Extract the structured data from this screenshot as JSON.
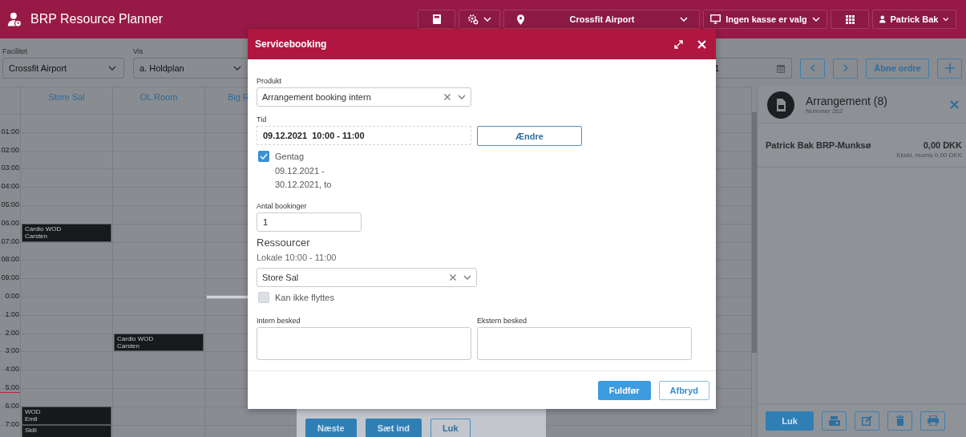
{
  "header": {
    "title": "BRP Resource Planner",
    "location": "Crossfit Airport",
    "register": "Ingen kasse er valg",
    "user": "Patrick Bak"
  },
  "toolbar": {
    "facility": {
      "label": "Facilitet",
      "value": "Crossfit Airport"
    },
    "view": {
      "label": "Vis",
      "value": "a. Holdplan"
    },
    "date": {
      "value": "1"
    },
    "open_orders_button": "Åbne ordre"
  },
  "calendar": {
    "columns": [
      "Store Sal",
      "OL Room",
      "Big R"
    ],
    "rows": [
      {
        "label": "01:00",
        "current": false
      },
      {
        "label": "02:00",
        "current": false
      },
      {
        "label": "03:00",
        "current": false
      },
      {
        "label": "04:00",
        "current": false
      },
      {
        "label": "05:00",
        "current": false
      },
      {
        "label": "06:00",
        "current": false,
        "cells": [
          {
            "kind": "booking",
            "title": "Cardio WOD",
            "subtitle": "Carsten"
          }
        ]
      },
      {
        "label": "07:00",
        "current": false
      },
      {
        "label": "08:00",
        "current": false
      },
      {
        "label": "09:00",
        "current": false
      },
      {
        "label": "0:00",
        "current": false,
        "cells": [
          {
            "kind": "empty"
          },
          {
            "kind": "empty"
          },
          {
            "kind": "selection"
          }
        ]
      },
      {
        "label": "1:00",
        "current": false
      },
      {
        "label": "2:00",
        "current": false,
        "cells": [
          {
            "kind": "empty"
          },
          {
            "kind": "booking",
            "title": "Cardio WOD",
            "subtitle": "Carsten"
          }
        ]
      },
      {
        "label": "3:00",
        "current": false
      },
      {
        "label": "4:00",
        "current": false
      },
      {
        "label": "5:00",
        "current": true
      },
      {
        "label": "6:00",
        "current": false,
        "cells": [
          {
            "kind": "booking",
            "title": "WOD",
            "subtitle": "Emil"
          }
        ]
      },
      {
        "label": "7:00",
        "current": false,
        "cells": [
          {
            "kind": "booking",
            "title": "Skill"
          }
        ]
      }
    ]
  },
  "popover": {
    "buttons": [
      {
        "label": "Næste",
        "kind": "primary"
      },
      {
        "label": "Sæt ind",
        "kind": "primary"
      },
      {
        "label": "Luk",
        "kind": "outline"
      }
    ]
  },
  "order_panel": {
    "title": "Arrangement (8)",
    "subtitle": "Nummer 262",
    "lines": [
      {
        "name": "Patrick Bak BRP-Munksø",
        "amount": "0,00 DKK",
        "note": "Ekskl. moms 0,00 DKK"
      }
    ],
    "close_button": "Luk"
  },
  "dialog": {
    "title": "Servicebooking",
    "product": {
      "label": "Produkt",
      "value": "Arrangement booking intern"
    },
    "time": {
      "label": "Tid",
      "value": "09.12.2021  10:00 - 11:00",
      "button": "Ændre"
    },
    "repeat": {
      "label": "Gentag",
      "checked": true,
      "lines": [
        "09.12.2021 -",
        "30.12.2021, to"
      ]
    },
    "count": {
      "label": "Antal bookinger",
      "value": "1"
    },
    "resources": {
      "heading": "Ressourcer",
      "subheading": "Lokale 10:00 - 11:00",
      "value": "Store Sal",
      "fixed": {
        "label": "Kan ikke flyttes",
        "checked": false
      }
    },
    "internal_note": {
      "label": "Intern besked"
    },
    "external_note": {
      "label": "Ekstern besked"
    },
    "buttons": [
      {
        "label": "Fuldfør",
        "kind": "primary"
      },
      {
        "label": "Afbryd",
        "kind": "outline"
      }
    ]
  }
}
